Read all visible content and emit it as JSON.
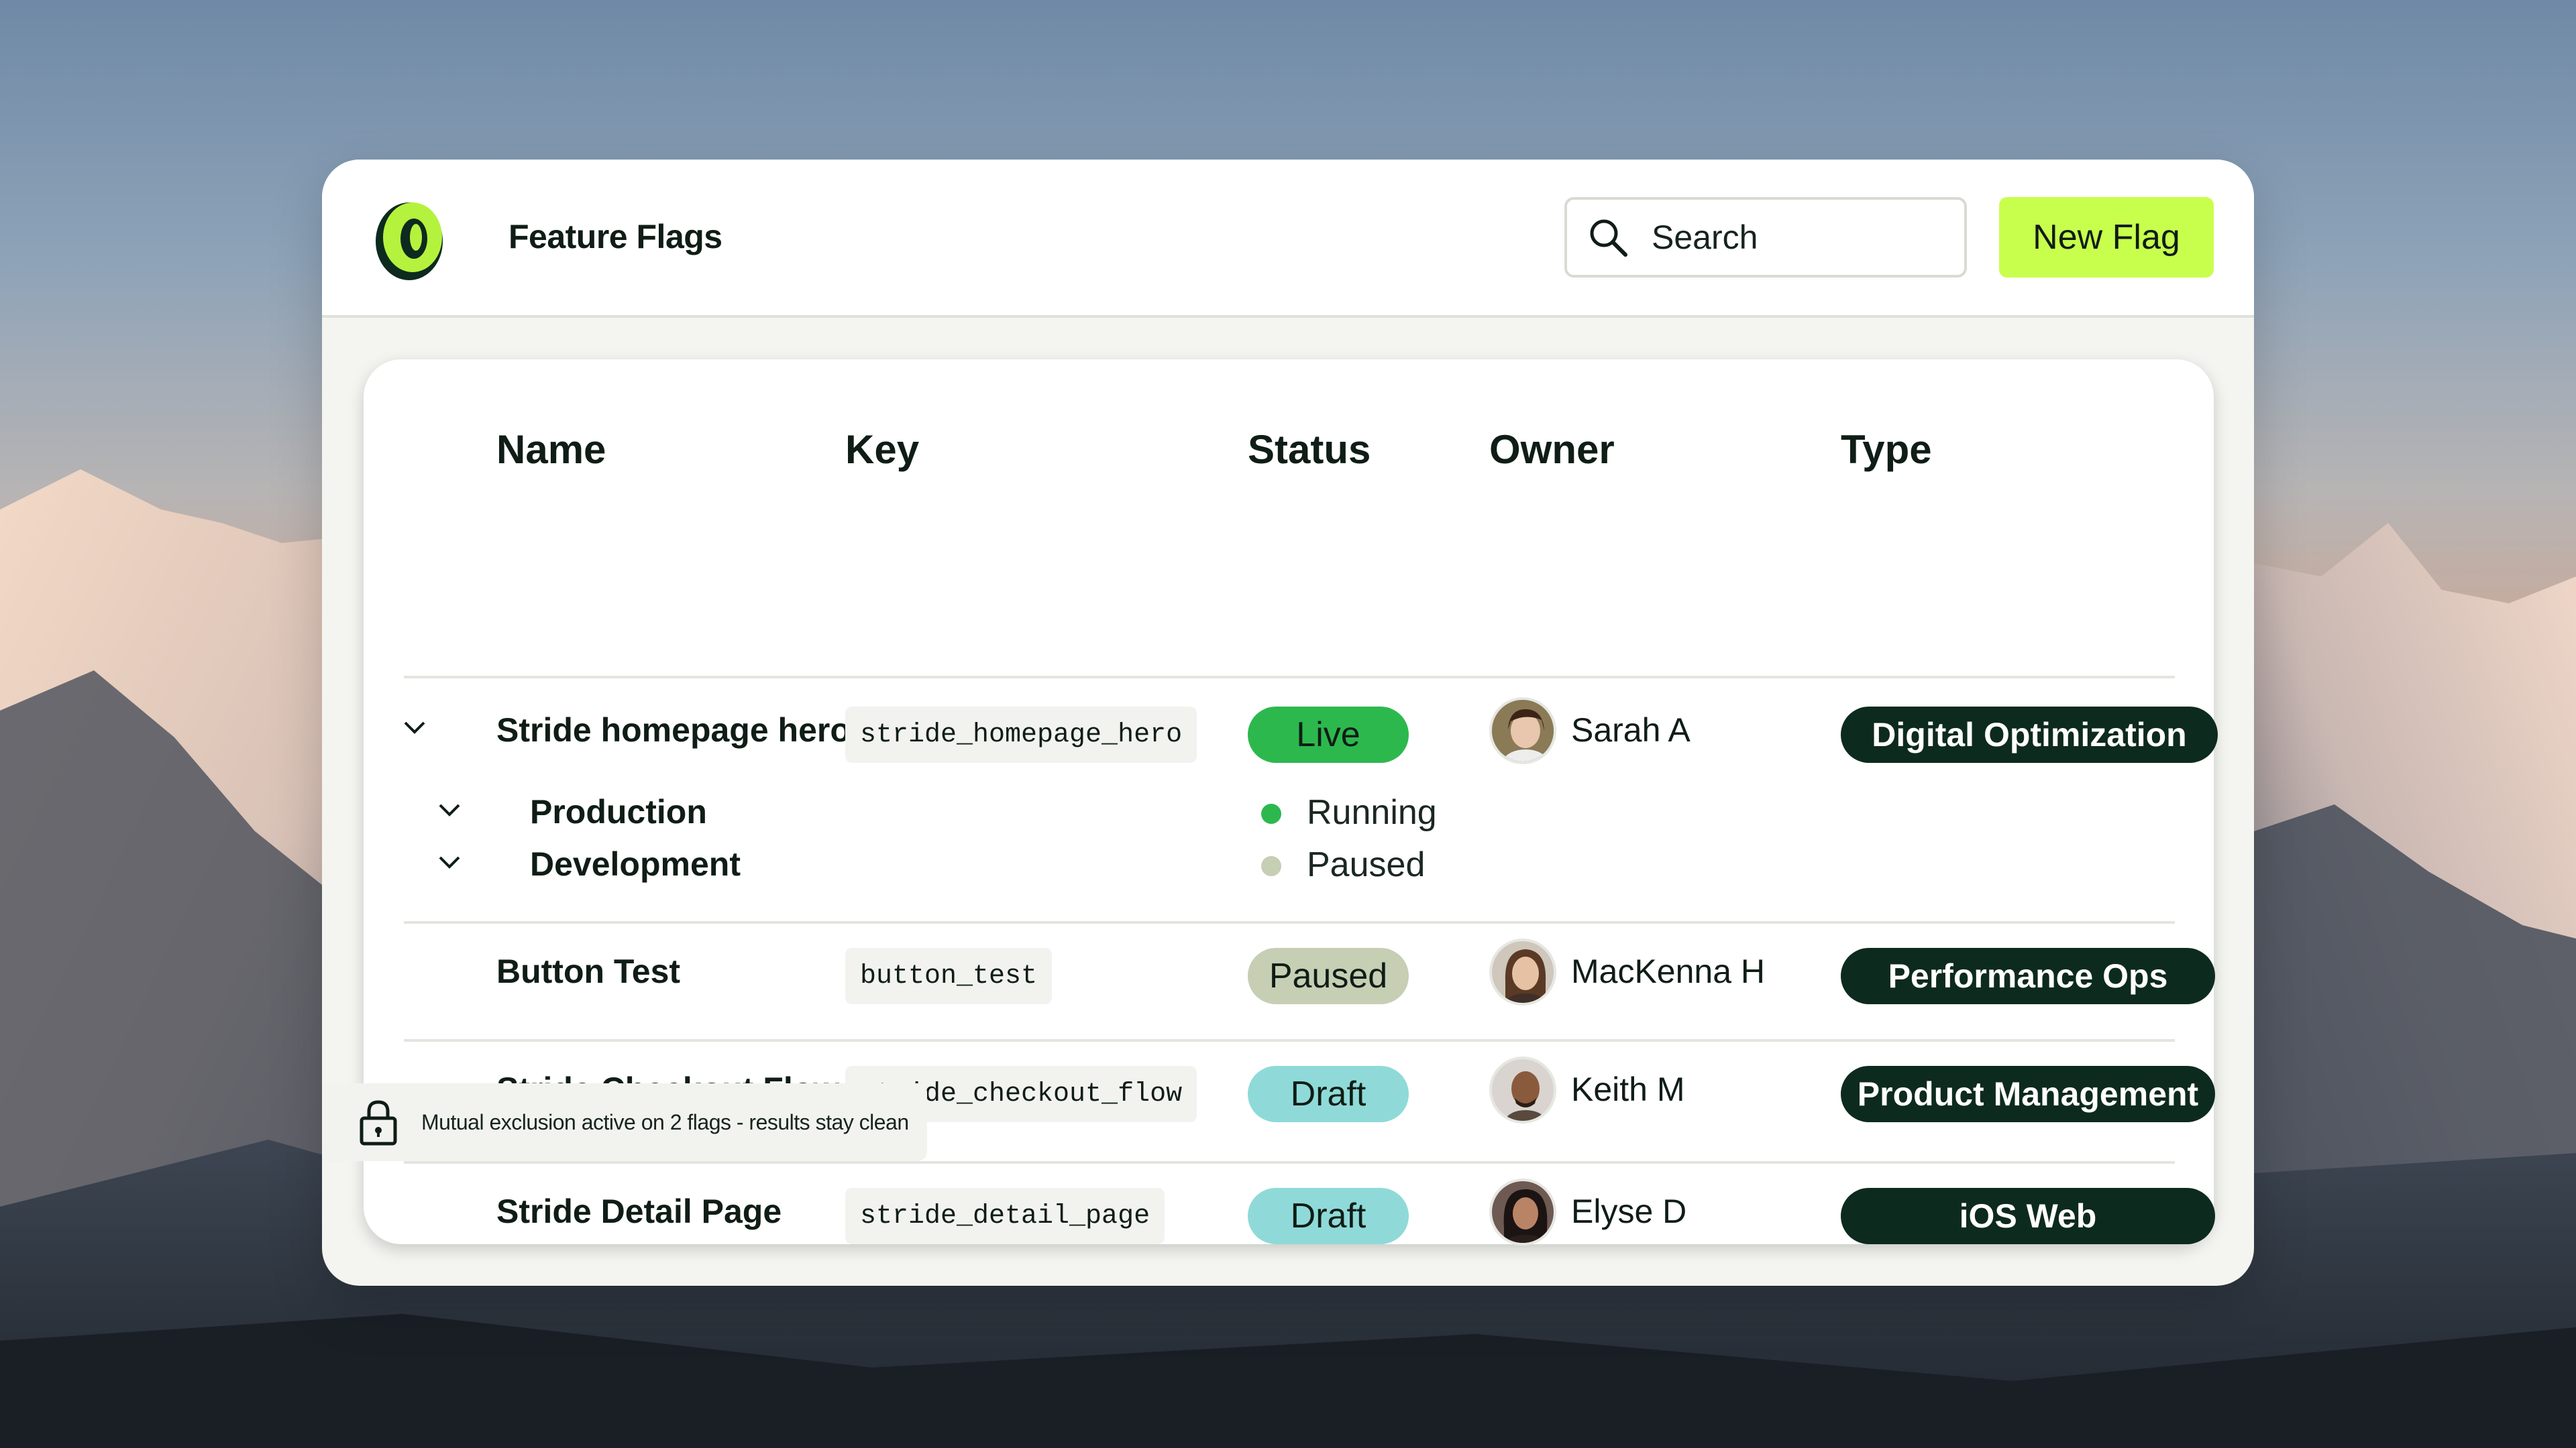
{
  "app": {
    "title": "Feature Flags",
    "logo": "ring-logo",
    "accent_color": "#c8ff4d"
  },
  "header": {
    "search_icon": "search-icon",
    "search_placeholder": "Search",
    "new_flag_label": "New Flag"
  },
  "table": {
    "columns": [
      "Name",
      "Key",
      "Status",
      "Owner",
      "Type"
    ],
    "rows": [
      {
        "name": "Stride homepage hero",
        "key": "stride_homepage_hero",
        "status": "Live",
        "status_color": "#2db84d",
        "owner": "Sarah A",
        "type": "Digital Optimization",
        "expanded": true,
        "environments": [
          {
            "name": "Production",
            "status": "Running",
            "dot_color": "#2db84d"
          },
          {
            "name": "Development",
            "status": "Paused",
            "dot_color": "#c6ceb4"
          }
        ]
      },
      {
        "name": "Button Test",
        "key": "button_test",
        "status": "Paused",
        "status_color": "#c6ceb4",
        "owner": "MacKenna H",
        "type": "Performance Ops"
      },
      {
        "name": "Stride Checkout Flow",
        "key": "stride_checkout_flow",
        "status": "Draft",
        "status_color": "#8fdad8",
        "owner": "Keith M",
        "type": "Product Management"
      },
      {
        "name": "Stride Detail Page",
        "key": "stride_detail_page",
        "status": "Draft",
        "status_color": "#8fdad8",
        "owner": "Elyse D",
        "type": "iOS Web"
      }
    ]
  },
  "footer_note": {
    "icon": "lock-icon",
    "text": "Mutual exclusion active on 2 flags - results stay clean"
  },
  "colors": {
    "type_badge_bg": "#0d2a1e",
    "card_bg": "#f4f5f0"
  }
}
